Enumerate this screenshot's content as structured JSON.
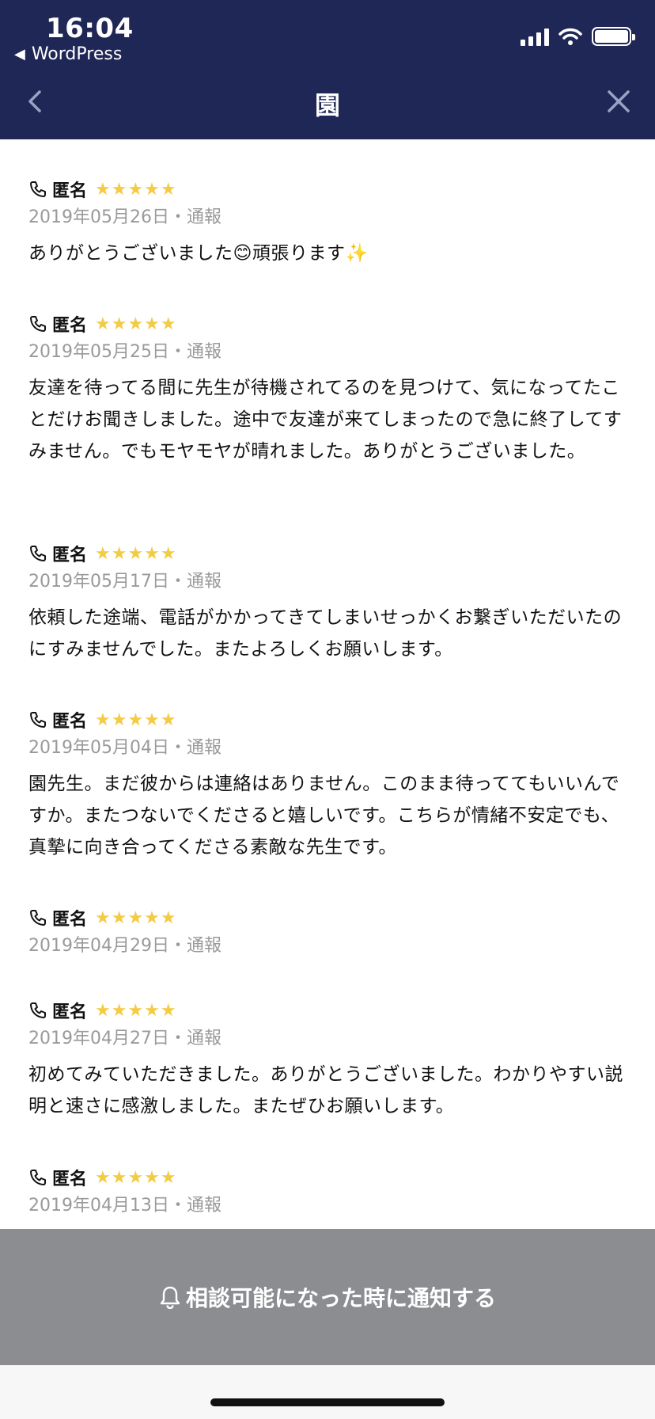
{
  "status": {
    "time": "16:04",
    "back_app": "WordPress"
  },
  "nav": {
    "title": "園"
  },
  "reviews": [
    {
      "name": "匿名",
      "stars": "★★★★★",
      "date": "2019年05月26日",
      "report": "・通報",
      "text": "ありがとうございました😊頑張ります✨"
    },
    {
      "name": "匿名",
      "stars": "★★★★★",
      "date": "2019年05月25日",
      "report": "・通報",
      "text": "友達を待ってる間に先生が待機されてるのを見つけて、気になってたことだけお聞きしました。途中で友達が来てしまったので急に終了してすみません。でもモヤモヤが晴れました。ありがとうございました。"
    },
    {
      "name": "匿名",
      "stars": "★★★★★",
      "date": "2019年05月17日",
      "report": "・通報",
      "text": "依頼した途端、電話がかかってきてしまいせっかくお繋ぎいただいたのにすみませんでした。またよろしくお願いします。"
    },
    {
      "name": "匿名",
      "stars": "★★★★★",
      "date": "2019年05月04日",
      "report": "・通報",
      "text": "園先生。まだ彼からは連絡はありません。このまま待っててもいいんですか。またつないでくださると嬉しいです。こちらが情緒不安定でも、真摯に向き合ってくださる素敵な先生です。"
    },
    {
      "name": "匿名",
      "stars": "★★★★★",
      "date": "2019年04月29日",
      "report": "・通報",
      "text": ""
    },
    {
      "name": "匿名",
      "stars": "★★★★★",
      "date": "2019年04月27日",
      "report": "・通報",
      "text": "初めてみていただきました。ありがとうございました。わかりやすい説明と速さに感激しました。またぜひお願いします。"
    },
    {
      "name": "匿名",
      "stars": "★★★★★",
      "date": "2019年04月13日",
      "report": "・通報",
      "text": ""
    }
  ],
  "notify_button": {
    "label": "相談可能になった時に通知する"
  },
  "colors": {
    "header_bg": "#1f2756",
    "star": "#f3cb45",
    "meta": "#9a9a9a",
    "notify_bg": "#8b8d91"
  }
}
